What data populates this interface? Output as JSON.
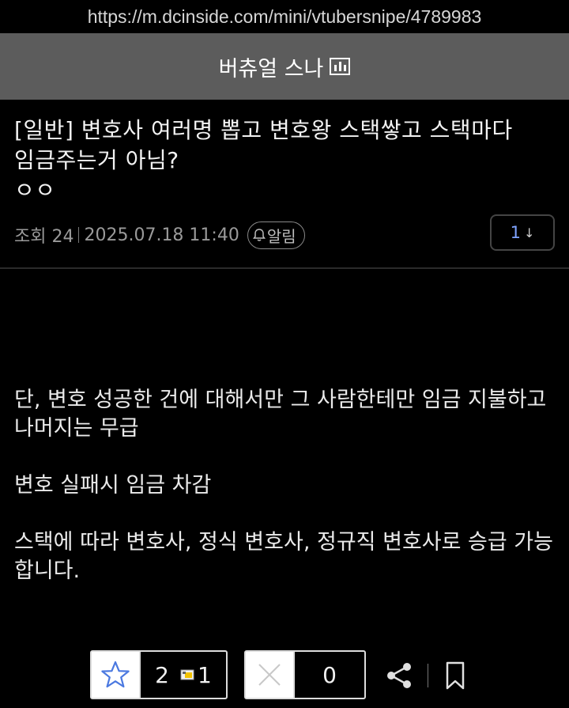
{
  "browser": {
    "url": "https://m.dcinside.com/mini/vtubersnipe/4789983"
  },
  "header": {
    "title": "버츄얼 스나"
  },
  "post": {
    "title_line1": "[일반] 변호사 여러명 뽑고 변호왕 스택쌓고 스택마다",
    "title_line2": "임금주는거 아님?",
    "title_line3": "ㅇㅇ",
    "views_label": "조회 24",
    "datetime": "2025.07.18 11:40",
    "alarm_label": "알림",
    "comment_count": "1",
    "comment_arrow": "↓",
    "body": [
      "단, 변호 성공한 건에 대해서만 그 사람한테만 임금 지불하고 나머지는 무급",
      "변호 실패시 임금 차감",
      "스택에 따라 변호사, 정식 변호사, 정규직 변호사로 승급 가능합니다."
    ]
  },
  "actions": {
    "recommend_count": "2",
    "fixed_recommend_count": "1",
    "nonrecommend_count": "0"
  },
  "icons": [
    "mini-gallery-icon",
    "bell-icon",
    "star-icon",
    "fixed-recommend-icon",
    "x-icon",
    "share-icon",
    "bookmark-icon"
  ],
  "colors": {
    "accent": "#7fa3ff",
    "header_bg": "#5c5c5c",
    "background": "#000000"
  }
}
